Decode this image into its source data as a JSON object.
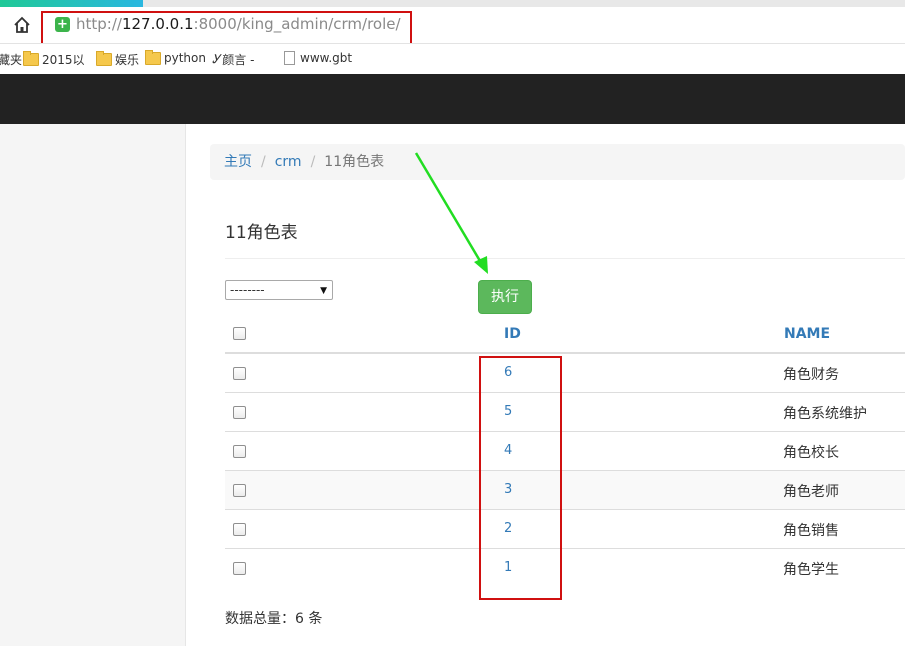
{
  "browser": {
    "url_prefix": "http://",
    "url_host": "127.0.0.1",
    "url_rest": ":8000/king_admin/crm/role/"
  },
  "bookmarks": [
    {
      "label": "藏夹",
      "icon": "none"
    },
    {
      "label": "2015以",
      "icon": "folder-icon"
    },
    {
      "label": "娱乐",
      "icon": "folder-icon"
    },
    {
      "label": "python",
      "icon": "folder-icon"
    },
    {
      "label": "颜言 -",
      "icon": "site-icon"
    },
    {
      "label": "www.gbt",
      "icon": "page-icon"
    }
  ],
  "breadcrumb": {
    "home": "主页",
    "app": "crm",
    "current": "11角色表",
    "separator": "/"
  },
  "page_title": "11角色表",
  "action_select": {
    "value": "--------"
  },
  "execute_button": {
    "label": "执行"
  },
  "table": {
    "headers": {
      "id": "ID",
      "name": "NAME"
    },
    "rows": [
      {
        "id": "6",
        "name": "角色财务"
      },
      {
        "id": "5",
        "name": "角色系统维护"
      },
      {
        "id": "4",
        "name": "角色校长"
      },
      {
        "id": "3",
        "name": "角色老师"
      },
      {
        "id": "2",
        "name": "角色销售"
      },
      {
        "id": "1",
        "name": "角色学生"
      }
    ]
  },
  "footer": {
    "total_label": "数据总量：",
    "total_count": "6",
    "total_unit": "条"
  },
  "colors": {
    "navbar": "#222222",
    "link": "#337ab7",
    "button_success": "#5cb85c",
    "annotation_red": "#d01010",
    "annotation_green": "#22dd22"
  }
}
